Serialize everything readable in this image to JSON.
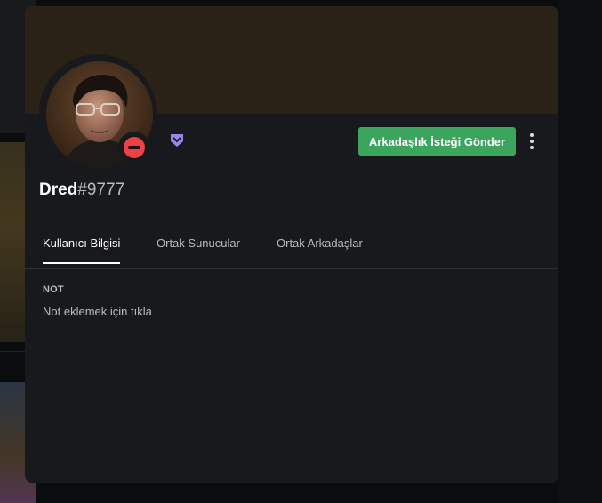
{
  "profile": {
    "username": "Dred",
    "discriminator": "#9777",
    "status": "do-not-disturb",
    "status_icon": "do-not-disturb-icon",
    "badge_icon": "hypesquad-icon",
    "avatar_icon": "user-avatar"
  },
  "actions": {
    "add_friend_label": "Arkadaşlık İsteği Gönder",
    "more_icon": "more-vertical-icon"
  },
  "tabs": [
    {
      "label": "Kullanıcı Bilgisi",
      "active": true
    },
    {
      "label": "Ortak Sunucular",
      "active": false
    },
    {
      "label": "Ortak Arkadaşlar",
      "active": false
    }
  ],
  "note": {
    "heading": "NOT",
    "placeholder": "Not eklemek için tıkla"
  },
  "colors": {
    "modal_bg": "#18191c",
    "banner": "#2a2216",
    "add_friend_button": "#3ba55d",
    "dnd_status": "#ed4245",
    "badge": "#9b84ec"
  }
}
